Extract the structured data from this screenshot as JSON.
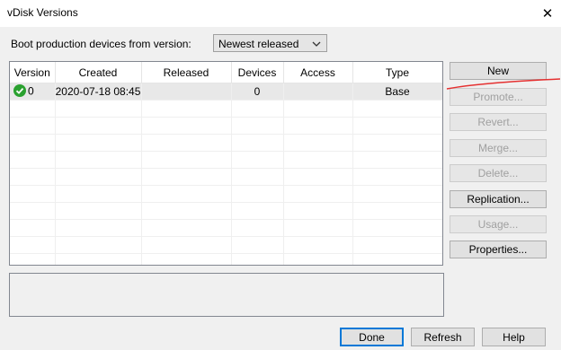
{
  "window": {
    "title": "vDisk Versions",
    "close_glyph": "✕"
  },
  "boot": {
    "label": "Boot production devices from version:",
    "selected": "Newest released",
    "chevron_glyph": "⌵"
  },
  "table": {
    "headers": [
      "Version",
      "Created",
      "Released",
      "Devices",
      "Access",
      "Type"
    ],
    "rows": [
      {
        "version": "0",
        "created": "2020-07-18 08:45",
        "released": "",
        "devices": "0",
        "access": "",
        "type": "Base"
      }
    ]
  },
  "buttons": {
    "new": "New",
    "promote": "Promote...",
    "revert": "Revert...",
    "merge": "Merge...",
    "delete": "Delete...",
    "replication": "Replication...",
    "usage": "Usage...",
    "properties": "Properties..."
  },
  "footer": {
    "done": "Done",
    "refresh": "Refresh",
    "help": "Help"
  },
  "colors": {
    "check": "#2aa12f",
    "annotation": "#e53030"
  }
}
